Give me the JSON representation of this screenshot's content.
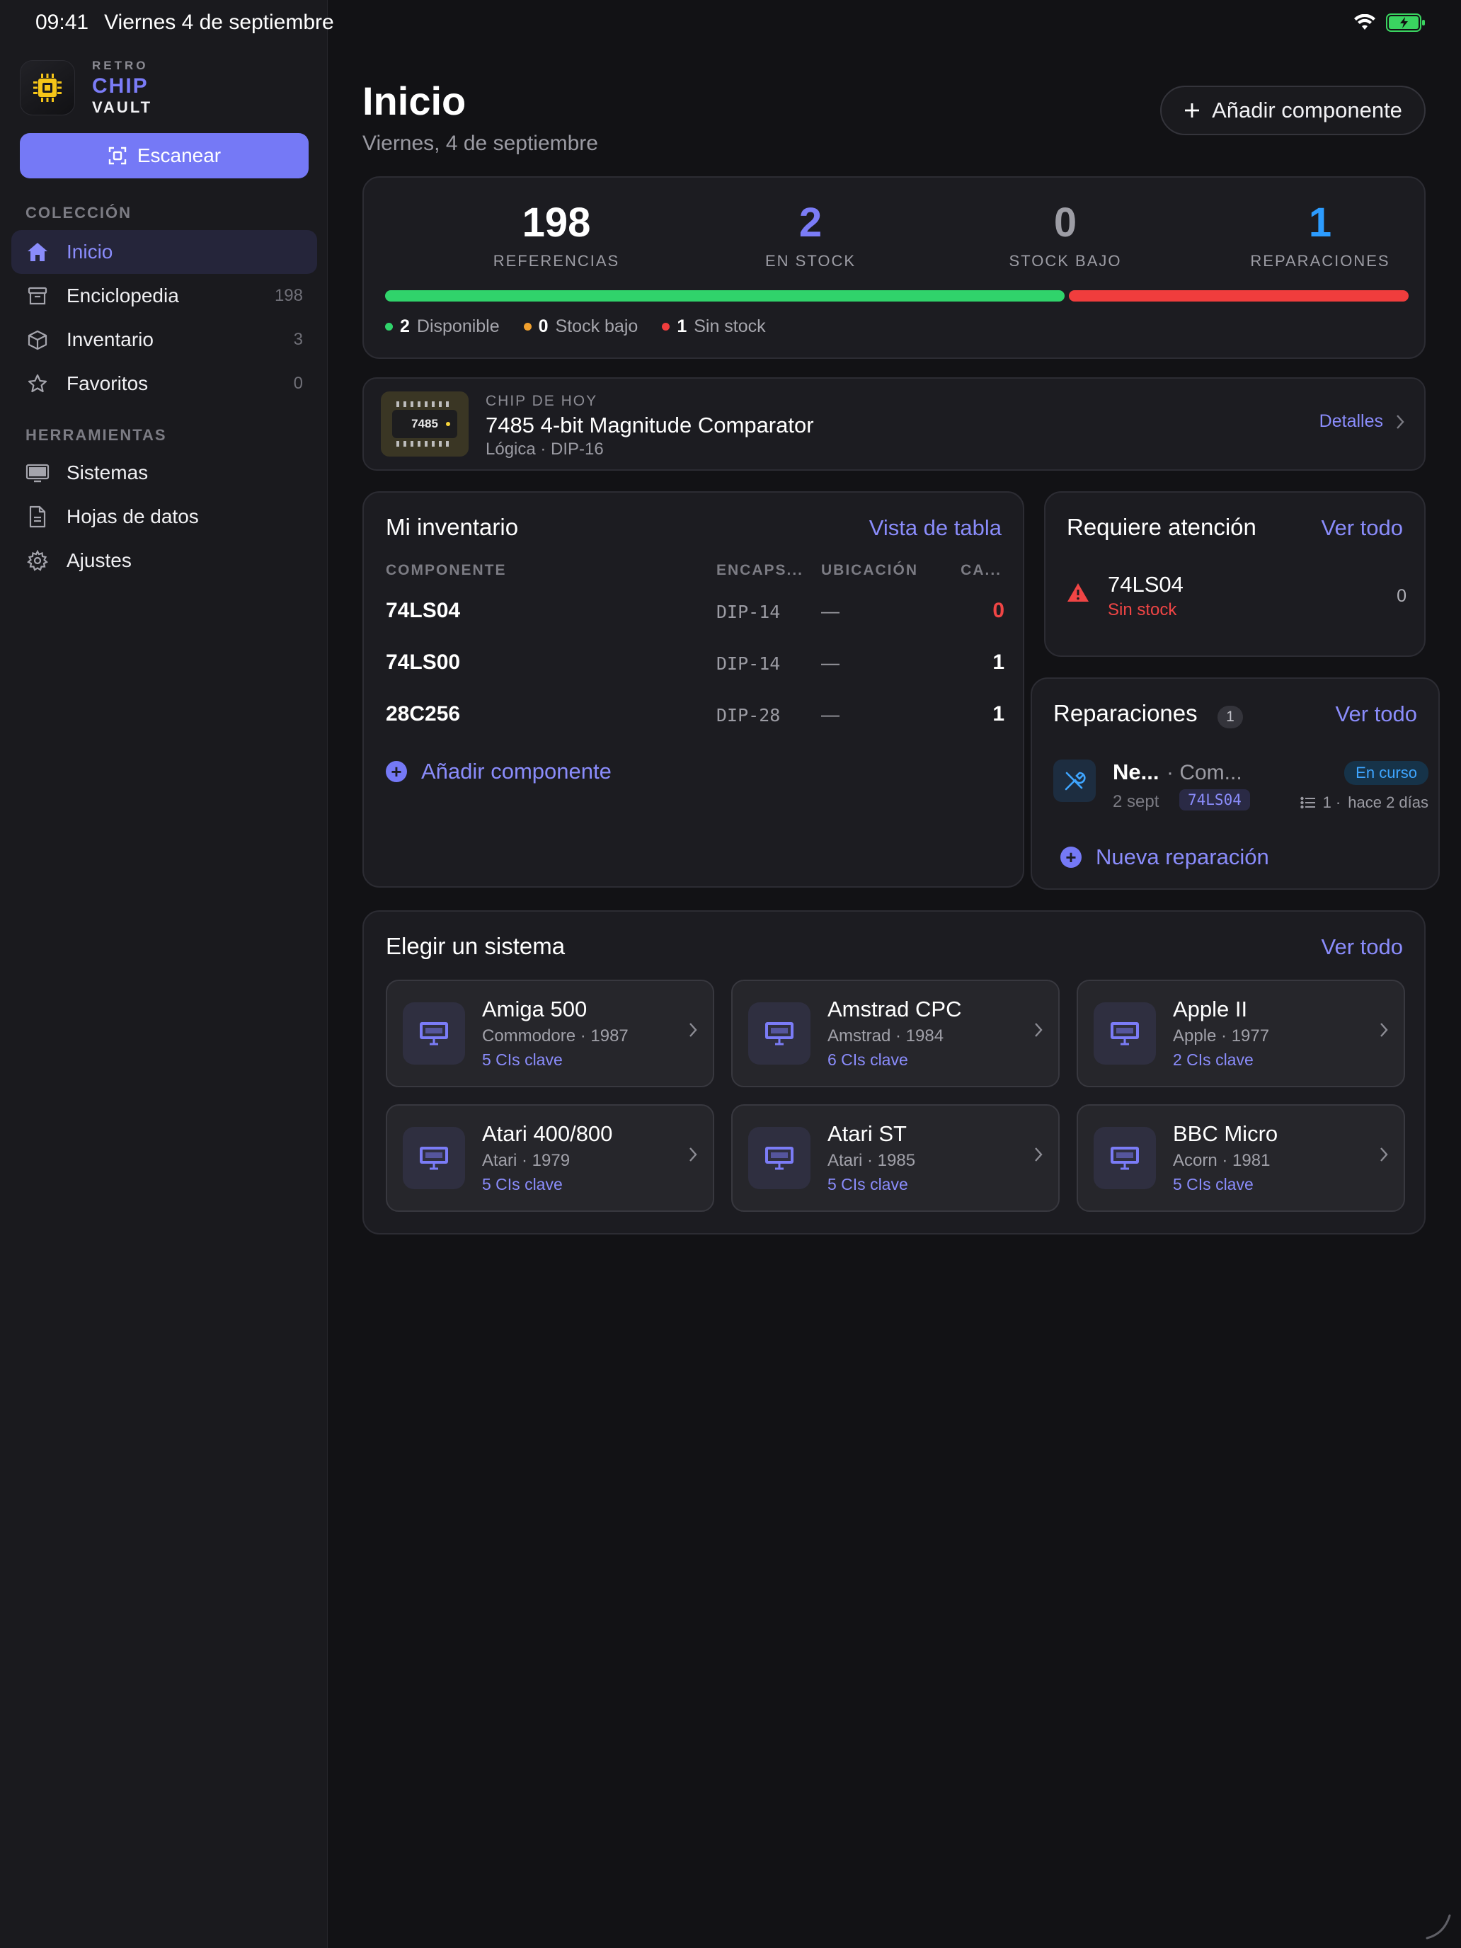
{
  "status_bar": {
    "time": "09:41",
    "date": "Viernes 4 de septiembre"
  },
  "brand": {
    "line1": "RETRO",
    "line2": "CHIP",
    "line3": "VAULT"
  },
  "sidebar": {
    "scan_label": "Escanear",
    "section_collection": "COLECCIÓN",
    "section_tools": "HERRAMIENTAS",
    "items": [
      {
        "label": "Inicio",
        "count": "",
        "icon": "house-icon",
        "active": true
      },
      {
        "label": "Enciclopedia",
        "count": "198",
        "icon": "archive-icon"
      },
      {
        "label": "Inventario",
        "count": "3",
        "icon": "box-icon"
      },
      {
        "label": "Favoritos",
        "count": "0",
        "icon": "star-icon"
      },
      {
        "label": "Sistemas",
        "count": "",
        "icon": "monitor-icon"
      },
      {
        "label": "Hojas de datos",
        "count": "",
        "icon": "document-icon"
      },
      {
        "label": "Ajustes",
        "count": "",
        "icon": "gear-icon"
      }
    ]
  },
  "header": {
    "title": "Inicio",
    "subtitle": "Viernes, 4 de septiembre",
    "add_label": "Añadir componente"
  },
  "stats": {
    "items": [
      {
        "value": "198",
        "label": "REFERENCIAS",
        "color": "#ffffff"
      },
      {
        "value": "2",
        "label": "EN STOCK",
        "color": "#7b7cf7"
      },
      {
        "value": "0",
        "label": "STOCK BAJO",
        "color": "#9d9da5"
      },
      {
        "value": "1",
        "label": "REPARACIONES",
        "color": "#2c9cff"
      }
    ],
    "legend": [
      {
        "value": "2",
        "label": "Disponible",
        "color": "#30d36b"
      },
      {
        "value": "0",
        "label": "Stock bajo",
        "color": "#f0a02e"
      },
      {
        "value": "1",
        "label": "Sin stock",
        "color": "#f03d3d"
      }
    ]
  },
  "chip_of_day": {
    "caption": "CHIP DE HOY",
    "chip_label": "7485",
    "title": "7485 4-bit Magnitude Comparator",
    "meta": "Lógica · DIP-16",
    "details_label": "Detalles"
  },
  "inventory": {
    "title": "Mi inventario",
    "link": "Vista de tabla",
    "headers": [
      "COMPONENTE",
      "ENCAPS...",
      "UBICACIÓN",
      "CA..."
    ],
    "rows": [
      {
        "name": "74LS04",
        "package": "DIP-14",
        "location": "—",
        "qty": "0",
        "qty_color": "#f04545"
      },
      {
        "name": "74LS00",
        "package": "DIP-14",
        "location": "—",
        "qty": "1",
        "qty_color": "#ffffff"
      },
      {
        "name": "28C256",
        "package": "DIP-28",
        "location": "—",
        "qty": "1",
        "qty_color": "#ffffff"
      }
    ],
    "add_label": "Añadir componente"
  },
  "attention": {
    "title": "Requiere atención",
    "link": "Ver todo",
    "item": {
      "name": "74LS04",
      "status": "Sin stock",
      "qty": "0"
    }
  },
  "repairs": {
    "title": "Reparaciones",
    "count": "1",
    "link": "Ver todo",
    "item": {
      "name": "Ne...",
      "sub": "· Com...",
      "date": "2 sept",
      "chip": "74LS04",
      "status": "En curso",
      "tasks": "1 ·",
      "ago": "hace 2 días"
    },
    "new_label": "Nueva reparación"
  },
  "systems": {
    "title": "Elegir un sistema",
    "link": "Ver todo",
    "items": [
      {
        "name": "Amiga 500",
        "maker": "Commodore · 1987",
        "keys": "5 CIs clave"
      },
      {
        "name": "Amstrad CPC",
        "maker": "Amstrad · 1984",
        "keys": "6 CIs clave"
      },
      {
        "name": "Apple II",
        "maker": "Apple · 1977",
        "keys": "2 CIs clave"
      },
      {
        "name": "Atari 400/800",
        "maker": "Atari · 1979",
        "keys": "5 CIs clave"
      },
      {
        "name": "Atari ST",
        "maker": "Atari · 1985",
        "keys": "5 CIs clave"
      },
      {
        "name": "BBC Micro",
        "maker": "Acorn · 1981",
        "keys": "5 CIs clave"
      }
    ]
  }
}
